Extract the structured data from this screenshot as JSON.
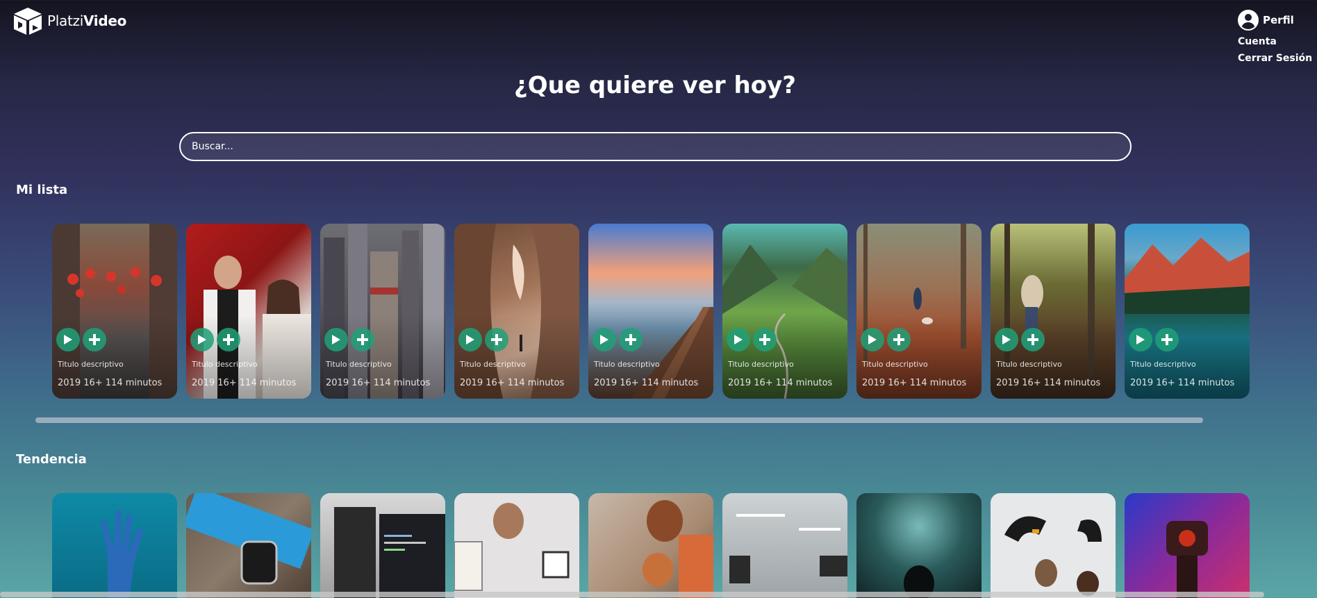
{
  "app": {
    "logo_light": "Platzi",
    "logo_bold": "Video",
    "logo_icon": "box-play-logo"
  },
  "profile": {
    "label": "Perfil",
    "menu": [
      "Cuenta",
      "Cerrar Sesión"
    ]
  },
  "main_title": "¿Que quiere ver hoy?",
  "search": {
    "placeholder": "Buscar..."
  },
  "sections": {
    "mi_lista": {
      "title": "Mi lista",
      "items": [
        {
          "title": "Titulo descriptivo",
          "meta": "2019 16+ 114 minutos",
          "image": "street-lanterns"
        },
        {
          "title": "Titulo descriptivo",
          "meta": "2019 16+ 114 minutos",
          "image": "couple-restaurant"
        },
        {
          "title": "Titulo descriptivo",
          "meta": "2019 16+ 114 minutos",
          "image": "city-skyscrapers"
        },
        {
          "title": "Titulo descriptivo",
          "meta": "2019 16+ 114 minutos",
          "image": "canyon-rocks"
        },
        {
          "title": "Titulo descriptivo",
          "meta": "2019 16+ 114 minutos",
          "image": "lake-pier-sunset"
        },
        {
          "title": "Titulo descriptivo",
          "meta": "2019 16+ 114 minutos",
          "image": "green-valley"
        },
        {
          "title": "Titulo descriptivo",
          "meta": "2019 16+ 114 minutos",
          "image": "autumn-forest-path"
        },
        {
          "title": "Titulo descriptivo",
          "meta": "2019 16+ 114 minutos",
          "image": "forest-couple"
        },
        {
          "title": "Titulo descriptivo",
          "meta": "2019 16+ 114 minutos",
          "image": "mountain-lake"
        }
      ]
    },
    "tendencia": {
      "title": "Tendencia",
      "items": [
        {
          "image": "robot-hand"
        },
        {
          "image": "smartwatch"
        },
        {
          "image": "computer-code"
        },
        {
          "image": "wall-decor"
        },
        {
          "image": "mother-child-laptop"
        },
        {
          "image": "office-space"
        },
        {
          "image": "silhouette-light"
        },
        {
          "image": "robot-arms-lab"
        },
        {
          "image": "robot-neon"
        }
      ]
    }
  },
  "icons": {
    "play": "play-icon",
    "add": "plus-icon",
    "avatar": "user-avatar-icon"
  },
  "colors": {
    "background_top": "#141420",
    "background_bottom": "#5aa6a6",
    "action_button": "#20a078"
  }
}
